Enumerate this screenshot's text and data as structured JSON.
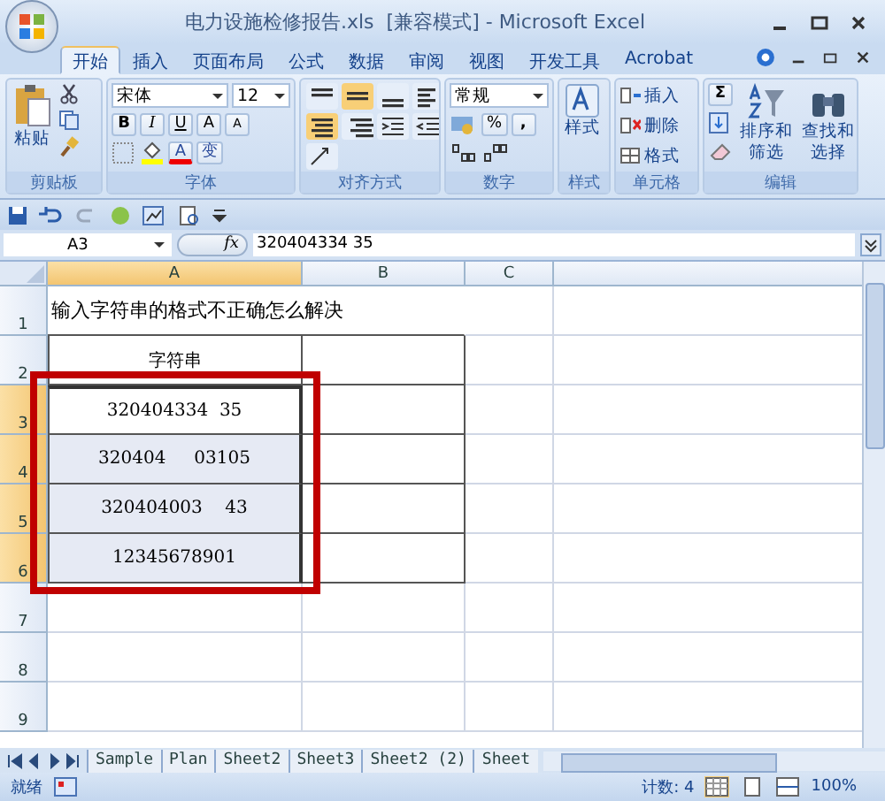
{
  "window": {
    "title": "电力设施检修报告.xls  [兼容模式] - Microsoft Excel"
  },
  "tabs": [
    {
      "label": "开始",
      "selected": true
    },
    {
      "label": "插入",
      "selected": false
    },
    {
      "label": "页面布局",
      "selected": false
    },
    {
      "label": "公式",
      "selected": false
    },
    {
      "label": "数据",
      "selected": false
    },
    {
      "label": "审阅",
      "selected": false
    },
    {
      "label": "视图",
      "selected": false
    },
    {
      "label": "开发工具",
      "selected": false
    },
    {
      "label": "Acrobat",
      "selected": false
    }
  ],
  "ribbon": {
    "paste": "粘贴",
    "font_name": "宋体",
    "font_size": "12",
    "bold": "B",
    "italic": "I",
    "underline": "U",
    "grow": "A",
    "shrink": "A",
    "font_color": "A",
    "wen": "变",
    "number_format": "常规",
    "percent": "%",
    "comma": ",",
    "styles": "样式",
    "insert": "插入",
    "delete": "删除",
    "format": "格式",
    "sigma": "Σ",
    "sort": [
      "排序和",
      "筛选"
    ],
    "find": [
      "查找和",
      "选择"
    ],
    "align_buttons": [
      {
        "kind": "top",
        "on": false
      },
      {
        "kind": "middle",
        "on": true
      },
      {
        "kind": "bottom",
        "on": false
      },
      {
        "kind": "left",
        "on": false
      },
      {
        "kind": "center",
        "on": true
      },
      {
        "kind": "right",
        "on": false
      }
    ],
    "groups": [
      "剪贴板",
      "字体",
      "对齐方式",
      "数字",
      "样式",
      "单元格",
      "编辑"
    ]
  },
  "formula_bar": {
    "name_box": "A3",
    "fx": "fx",
    "value": "320404334 35"
  },
  "columns": [
    {
      "label": "A",
      "selected": true
    },
    {
      "label": "B",
      "selected": false
    },
    {
      "label": "C",
      "selected": false
    }
  ],
  "rows": [
    {
      "number": "1",
      "selected": false,
      "bordered": false,
      "cell": {
        "kind": "title",
        "text": "输入字符串的格式不正确怎么解决",
        "selected": false
      }
    },
    {
      "number": "2",
      "selected": false,
      "bordered": true,
      "cell": {
        "kind": "value",
        "text": "字符串",
        "selected": false
      }
    },
    {
      "number": "3",
      "selected": true,
      "bordered": true,
      "cell": {
        "kind": "value",
        "text": "320404334  35",
        "selected": true,
        "active": true
      }
    },
    {
      "number": "4",
      "selected": true,
      "bordered": true,
      "cell": {
        "kind": "value",
        "text": "320404     03105",
        "selected": true
      }
    },
    {
      "number": "5",
      "selected": true,
      "bordered": true,
      "cell": {
        "kind": "value",
        "text": "320404003    43",
        "selected": true
      }
    },
    {
      "number": "6",
      "selected": true,
      "bordered": true,
      "cell": {
        "kind": "value",
        "text": "12345678901",
        "selected": true
      }
    },
    {
      "number": "7",
      "selected": false,
      "bordered": false
    },
    {
      "number": "8",
      "selected": false,
      "bordered": false
    },
    {
      "number": "9",
      "selected": false,
      "bordered": false
    }
  ],
  "sheet_tabs": [
    "Sample",
    "Plan",
    "Sheet2",
    "Sheet3",
    "Sheet2 (2)",
    "Sheet"
  ],
  "status_bar": {
    "ready": "就绪",
    "count": "计数: 4",
    "zoom": "100%"
  }
}
